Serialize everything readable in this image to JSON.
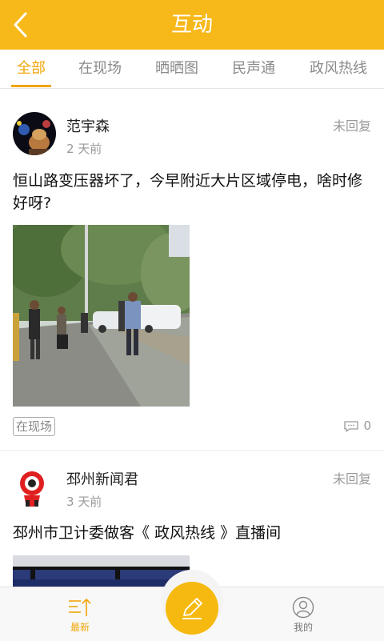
{
  "header": {
    "title": "互动",
    "back_icon": "chevron-left-icon"
  },
  "tabs": [
    {
      "label": "全部",
      "active": true
    },
    {
      "label": "在现场",
      "active": false
    },
    {
      "label": "晒晒图",
      "active": false
    },
    {
      "label": "民声通",
      "active": false
    },
    {
      "label": "政风热线",
      "active": false
    }
  ],
  "posts": [
    {
      "username": "范宇森",
      "time": "2 天前",
      "status": "未回复",
      "content": "恒山路变压器坏了，今早附近大片区域停电，啥时修好呀?",
      "tag": "在现场",
      "comments": "0"
    },
    {
      "username": "邳州新闻君",
      "time": "3 天前",
      "status": "未回复",
      "content": "邳州市卫计委做客《 政风热线 》直播间"
    }
  ],
  "bottom_nav": {
    "latest_label": "最新",
    "mine_label": "我的",
    "compose_icon": "pencil-icon"
  },
  "colors": {
    "accent": "#f7b81a",
    "active_tab": "#f0a60a",
    "fab": "#f6b90f"
  }
}
